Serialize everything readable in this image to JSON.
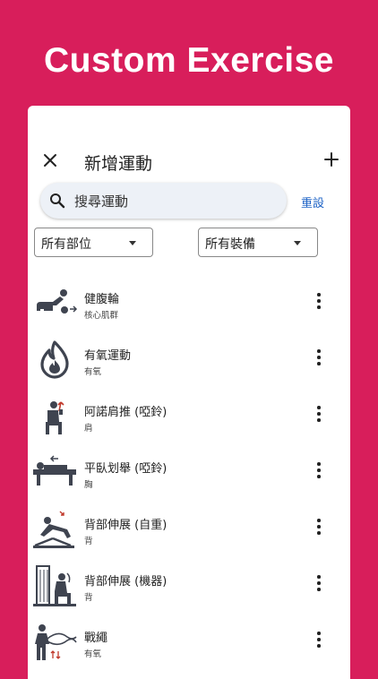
{
  "hero": {
    "title": "Custom Exercise"
  },
  "appbar": {
    "title": "新增運動",
    "close_icon": "close-icon",
    "add_icon": "plus-icon"
  },
  "search": {
    "placeholder": "搜尋運動",
    "value": "",
    "reset_label": "重設"
  },
  "filters": {
    "body_part": "所有部位",
    "equipment": "所有裝備"
  },
  "exercises": [
    {
      "name": "健腹輪",
      "category": "核心肌群",
      "icon": "ab-wheel-icon"
    },
    {
      "name": "有氧運動",
      "category": "有氧",
      "icon": "flame-icon"
    },
    {
      "name": "阿諾肩推 (啞鈴)",
      "category": "肩",
      "icon": "arnold-press-icon"
    },
    {
      "name": "平臥划舉 (啞鈴)",
      "category": "胸",
      "icon": "bench-row-icon"
    },
    {
      "name": "背部伸展 (自重)",
      "category": "背",
      "icon": "back-extension-bodyweight-icon"
    },
    {
      "name": "背部伸展 (機器)",
      "category": "背",
      "icon": "back-extension-machine-icon"
    },
    {
      "name": "戰繩",
      "category": "有氧",
      "icon": "battle-rope-icon"
    }
  ],
  "colors": {
    "background": "#D81E5B",
    "accent": "#1E63C6",
    "icon": "#3F4450"
  }
}
